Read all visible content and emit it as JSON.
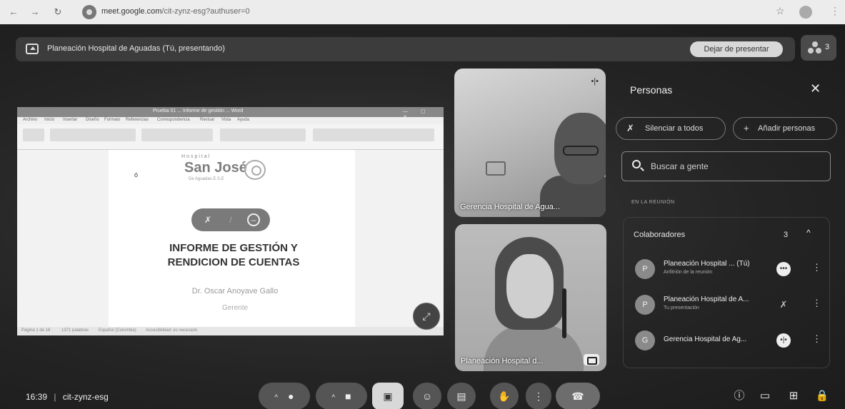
{
  "browser": {
    "nav_back": "←",
    "nav_forward": "→",
    "nav_reload": "↻",
    "url_domain": "meet.google.com",
    "url_path": "/cit-zynz-esg?authuser=0",
    "star": "☆",
    "menu": "⋮"
  },
  "presenting": {
    "banner_text": "Planeación Hospital de Aguadas (Tú, presentando)",
    "stop_button": "Dejar de presentar",
    "participant_count": "3"
  },
  "shared_screen": {
    "app": "Word",
    "window_title": "Prueba 01 ... Informe de gestión ... Word",
    "window_controls": "— ▢ ✕",
    "menu_tabs": [
      "Archivo",
      "Inicio",
      "Insertar",
      "Diseño",
      "Formato",
      "Referencias",
      "Correspondencia",
      "Revisar",
      "Vista",
      "Ayuda"
    ],
    "cursor_mark": "ó",
    "logo_top": "Hospital",
    "logo_name": "San José",
    "logo_sub": "De Aguadas E.S.E",
    "title_line1": "INFORME DE GESTIÓN Y",
    "title_line2": "RENDICION DE CUENTAS",
    "author": "Dr. Oscar Anoyave Gallo",
    "role": "Gerente",
    "status_items": [
      "Página 1 de 18",
      "1371 palabras",
      "Español (Colombia)",
      "Accesibilidad: es necesario"
    ]
  },
  "tiles": [
    {
      "name": "Gerencia Hospital de Agua..."
    },
    {
      "name": "Planeación Hospital d..."
    }
  ],
  "people_panel": {
    "title": "Personas",
    "close": "✕",
    "mute_all": "Silenciar a todos",
    "add_people": "Añadir personas",
    "search_placeholder": "Buscar a gente",
    "section_label": "EN LA REUNIÓN",
    "group_label": "Colaboradores",
    "group_count": "3",
    "participants": [
      {
        "initial": "P",
        "name": "Planeación Hospital ... (Tú)",
        "subtitle": "Anfitrión de la reunión",
        "state": "•••"
      },
      {
        "initial": "P",
        "name": "Planeación Hospital de A...",
        "subtitle": "Tu presentación",
        "state": "mic-off"
      },
      {
        "initial": "G",
        "name": "Gerencia Hospital de Ag...",
        "subtitle": "",
        "state": "speaking"
      }
    ]
  },
  "bottom_bar": {
    "time": "16:39",
    "separator": "|",
    "meeting_code": "cit-zynz-esg"
  },
  "colors": {
    "stage_bg": "#242424",
    "panel_text": "#f0f0f0",
    "active_control": "#d8d8d8"
  }
}
